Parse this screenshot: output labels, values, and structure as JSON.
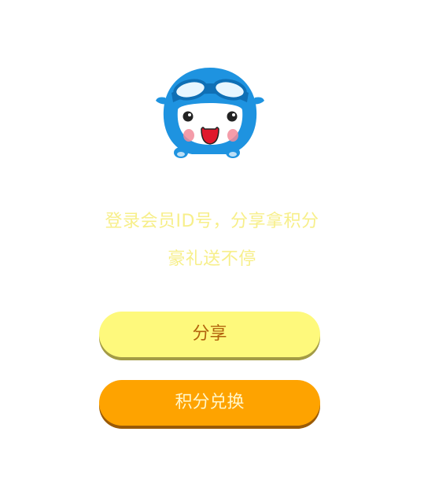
{
  "mascot": {
    "icon": "cartoon-mascot-pilot-icon"
  },
  "promo": {
    "line1": "登录会员ID号，分享拿积分",
    "line2": "豪礼送不停"
  },
  "buttons": {
    "share_label": "分享",
    "exchange_label": "积分兑换"
  },
  "colors": {
    "promo_text": "#f7ef8a",
    "share_bg": "#fef97c",
    "share_text": "#b2620c",
    "exchange_bg": "#fea300",
    "exchange_text": "#fff6c9",
    "mascot_blue": "#1e93e0"
  }
}
